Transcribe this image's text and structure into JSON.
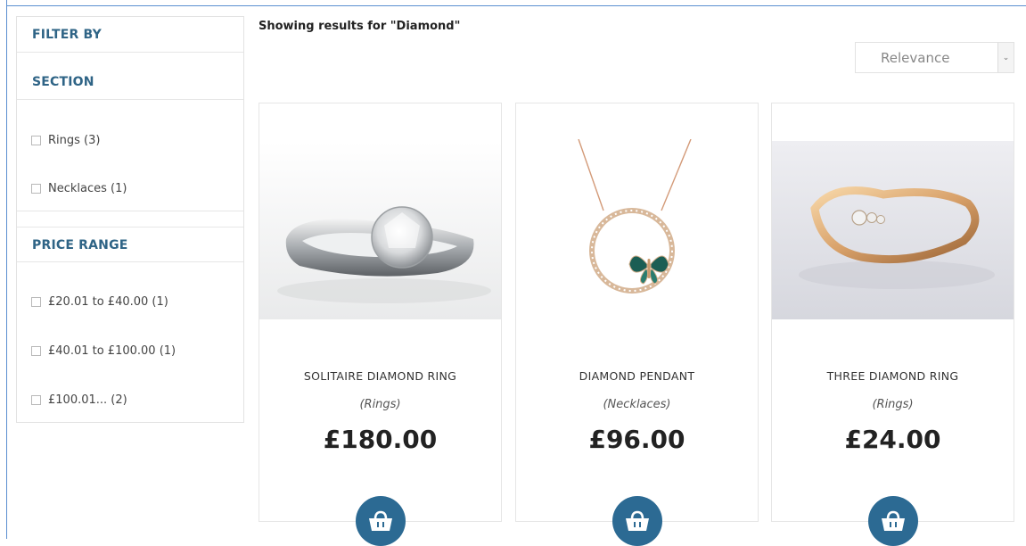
{
  "sidebar": {
    "filter_by": "FILTER BY",
    "section": {
      "title": "SECTION",
      "options": [
        {
          "label": "Rings (3)",
          "checked": false
        },
        {
          "label": "Necklaces (1)",
          "checked": false
        }
      ]
    },
    "price_range": {
      "title": "PRICE RANGE",
      "options": [
        {
          "label": "£20.01 to £40.00 (1)",
          "checked": false
        },
        {
          "label": "£40.01 to £100.00 (1)",
          "checked": false
        },
        {
          "label": "£100.01... (2)",
          "checked": false
        }
      ]
    }
  },
  "results": {
    "title": "Showing results for \"Diamond\""
  },
  "sort": {
    "selected": "Relevance"
  },
  "products": [
    {
      "name": "SOLITAIRE DIAMOND RING",
      "category": "(Rings)",
      "price": "£180.00",
      "image": "solitaire-ring-image"
    },
    {
      "name": "DIAMOND PENDANT",
      "category": "(Necklaces)",
      "price": "£96.00",
      "image": "butterfly-pendant-image"
    },
    {
      "name": "THREE DIAMOND RING",
      "category": "(Rings)",
      "price": "£24.00",
      "image": "gold-ring-image"
    }
  ],
  "colors": {
    "accent": "#2c6a93",
    "heading": "#2f6486"
  },
  "icons": {
    "cart": "shopping-basket-icon",
    "dropdown": "chevron-down-icon"
  }
}
